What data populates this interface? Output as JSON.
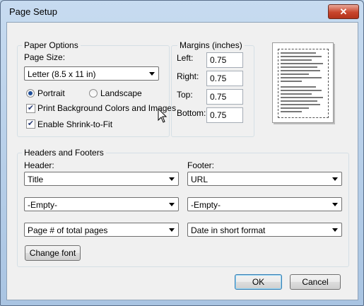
{
  "window": {
    "title": "Page Setup",
    "close_glyph": "✕"
  },
  "paper_options": {
    "group_label": "Paper Options",
    "page_size_label": "Page Size:",
    "page_size_value": "Letter (8.5 x 11 in)",
    "portrait_label": "Portrait",
    "landscape_label": "Landscape",
    "orientation_selected": "Portrait",
    "print_bg_label": "Print Background Colors and Images",
    "print_bg_checked": true,
    "shrink_label": "Enable Shrink-to-Fit",
    "shrink_checked": true
  },
  "margins": {
    "group_label": "Margins (inches)",
    "left_label": "Left:",
    "left_value": "0.75",
    "right_label": "Right:",
    "right_value": "0.75",
    "top_label": "Top:",
    "top_value": "0.75",
    "bottom_label": "Bottom:",
    "bottom_value": "0.75"
  },
  "headers_footers": {
    "group_label": "Headers and Footers",
    "header_label": "Header:",
    "footer_label": "Footer:",
    "header_values": [
      "Title",
      "-Empty-",
      "Page # of total pages"
    ],
    "footer_values": [
      "URL",
      "-Empty-",
      "Date in short format"
    ],
    "change_font_label": "Change font"
  },
  "buttons": {
    "ok_label": "OK",
    "cancel_label": "Cancel"
  }
}
